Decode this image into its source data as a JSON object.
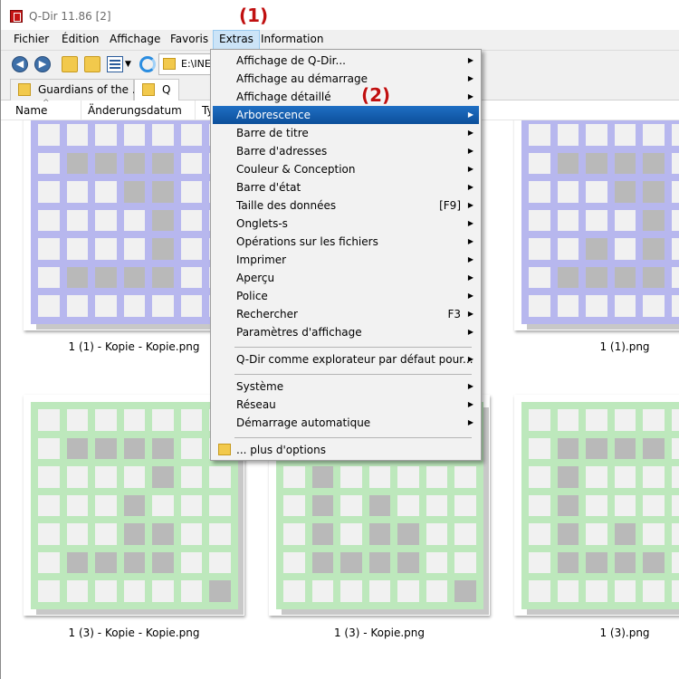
{
  "window": {
    "title": "Q-Dir 11.86 [2]"
  },
  "menubar": [
    "Fichier",
    "Édition",
    "Affichage",
    "Favoris",
    "Extras",
    "Information"
  ],
  "address": {
    "path": "E:\\INE"
  },
  "tabs": [
    {
      "label": "Guardians of the ..."
    },
    {
      "label": "Q"
    }
  ],
  "columns": [
    "Name",
    "Änderungsdatum",
    "Ty"
  ],
  "files": [
    "1 (1) - Kopie - Kopie.png",
    "1 (1).png",
    "1 (3) - Kopie - Kopie.png",
    "1 (3) - Kopie.png",
    "1 (3).png"
  ],
  "extras_menu": {
    "items": [
      {
        "label": "Affichage de Q-Dir...",
        "submenu": true
      },
      {
        "label": "Affichage au démarrage",
        "submenu": true
      },
      {
        "label": "Affichage détaillé",
        "submenu": true
      },
      {
        "label": "Arborescence",
        "submenu": true,
        "highlighted": true
      },
      {
        "label": "Barre de titre",
        "submenu": true
      },
      {
        "label": "Barre d'adresses",
        "submenu": true
      },
      {
        "label": "Couleur & Conception",
        "submenu": true
      },
      {
        "label": "Barre d'état",
        "submenu": true
      },
      {
        "label": "Taille des données",
        "shortcut": "[F9]",
        "submenu": true
      },
      {
        "label": "Onglets-s",
        "submenu": true
      },
      {
        "label": "Opérations sur les fichiers",
        "submenu": true
      },
      {
        "label": "Imprimer",
        "submenu": true
      },
      {
        "label": "Aperçu",
        "submenu": true
      },
      {
        "label": "Police",
        "submenu": true
      },
      {
        "label": "Rechercher",
        "shortcut": "F3",
        "submenu": true
      },
      {
        "label": "Paramètres d'affichage",
        "submenu": true
      },
      {
        "label": "Q-Dir comme explorateur par défaut pour...",
        "submenu": true
      },
      {
        "label": "Système",
        "submenu": true
      },
      {
        "label": "Réseau",
        "submenu": true
      },
      {
        "label": "Démarrage automatique",
        "submenu": true
      },
      {
        "label": "... plus d'options",
        "submenu": false
      }
    ]
  },
  "annotations": [
    "(1)",
    "(2)"
  ],
  "colors": {
    "highlight": "#1a66b8",
    "annotation": "#c01010",
    "thumb_blue": "#b7b7ee",
    "thumb_green": "#bde8bc"
  }
}
